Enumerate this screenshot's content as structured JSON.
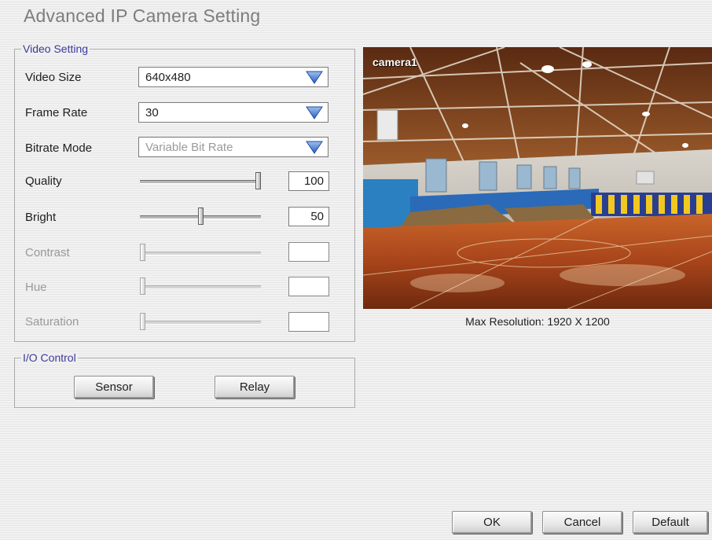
{
  "dialog": {
    "title": "Advanced IP Camera Setting"
  },
  "video_setting": {
    "legend": "Video Setting",
    "video_size": {
      "label": "Video Size",
      "value": "640x480"
    },
    "frame_rate": {
      "label": "Frame Rate",
      "value": "30"
    },
    "bitrate_mode": {
      "label": "Bitrate Mode",
      "value": "Variable Bit Rate",
      "enabled": false
    },
    "sliders": [
      {
        "label": "Quality",
        "value": "100",
        "level": 1.0,
        "enabled": true
      },
      {
        "label": "Bright",
        "value": "50",
        "level": 0.5,
        "enabled": true
      },
      {
        "label": "Contrast",
        "value": "",
        "level": 0.0,
        "enabled": false
      },
      {
        "label": "Hue",
        "value": "",
        "level": 0.0,
        "enabled": false
      },
      {
        "label": "Saturation",
        "value": "",
        "level": 0.0,
        "enabled": false
      }
    ]
  },
  "io_control": {
    "legend": "I/O Control",
    "sensor_label": "Sensor",
    "relay_label": "Relay"
  },
  "preview": {
    "camera_name": "camera1",
    "max_resolution": "Max Resolution: 1920 X 1200"
  },
  "footer": {
    "ok_label": "OK",
    "cancel_label": "Cancel",
    "default_label": "Default"
  },
  "colors": {
    "legend_text": "#3a3a9c",
    "dropdown_arrow": "#4a7fd6",
    "court_floor": "#b5541f"
  },
  "icons": {
    "dropdown": "triangle-down-icon"
  }
}
